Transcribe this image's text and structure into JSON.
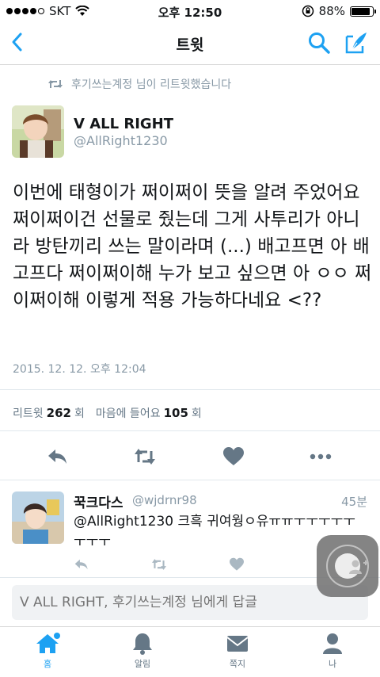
{
  "status_bar": {
    "carrier": "SKT",
    "time": "오후 12:50",
    "battery_percent": "88%",
    "battery_level": 0.88
  },
  "nav": {
    "title": "트윗",
    "back_icon": "chevron-left-icon",
    "search_icon": "search-icon",
    "compose_icon": "compose-feather-icon"
  },
  "retweet_context": {
    "text": "후기쓰는계정 님이 리트윗했습니다"
  },
  "tweet": {
    "author_name": "V ALL RIGHT",
    "author_handle": "@AllRight1230",
    "text": "이번에 태형이가 쩌이쩌이 뜻을 알려 주었어요 쩌이쩌이건 선물로 줬는데 그게 사투리가 아니라 방탄끼리 쓰는 말이라며 (...) 배고프면 아 배고프다 쩌이쩌이해 누가 보고 싶으면 아 ㅇㅇ 쩌이쩌이해 이렇게 적용 가능하다네요 <??",
    "date": "2015. 12. 12. 오후 12:04",
    "retweet_label": "리트윗",
    "retweet_count": "262",
    "retweet_unit": "회",
    "like_label": "마음에 들어요",
    "like_count": "105",
    "like_unit": "회"
  },
  "reply": {
    "name": "꾹크다스",
    "handle": "@wjdrnr98",
    "time": "45분",
    "text": "@AllRight1230 크흑 귀여웡ㅇ유ㅠㅠㅜㅜㅜㅜㅜㅜㅜㅜ"
  },
  "reply_box": {
    "placeholder": "V ALL RIGHT, 후기쓰는계정 님에게 답글"
  },
  "tab_bar": {
    "tabs": [
      {
        "label": "홈",
        "icon": "home-icon"
      },
      {
        "label": "알림",
        "icon": "bell-icon"
      },
      {
        "label": "쪽지",
        "icon": "envelope-icon"
      },
      {
        "label": "나",
        "icon": "person-icon"
      }
    ]
  },
  "colors": {
    "accent": "#1da1f2",
    "secondary_text": "#8899a6",
    "icon_gray": "#8899a6"
  }
}
